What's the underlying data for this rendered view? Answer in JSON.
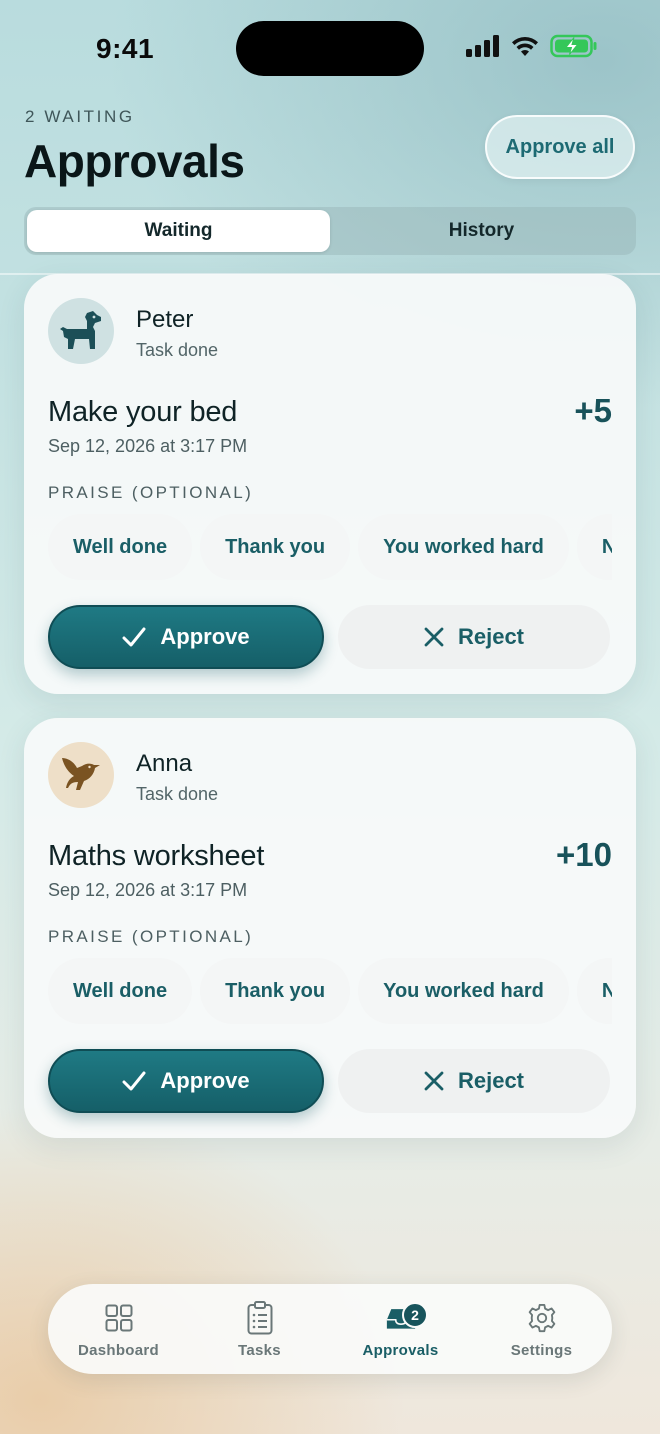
{
  "status_bar": {
    "time": "9:41"
  },
  "header": {
    "waiting_count": "2 WAITING",
    "title": "Approvals",
    "approve_all_label": "Approve all"
  },
  "segments": [
    {
      "label": "Waiting",
      "active": true
    },
    {
      "label": "History",
      "active": false
    }
  ],
  "approvals": [
    {
      "child_name": "Peter",
      "status": "Task done",
      "avatar_icon": "dog-icon",
      "avatar_bg": "#cfe1e2",
      "task_title": "Make your bed",
      "date": "Sep 12, 2026 at 3:17 PM",
      "points": "+5",
      "praise_label": "PRAISE (OPTIONAL)",
      "praise_chips": [
        "Well done",
        "Thank you",
        "You worked hard",
        "N"
      ],
      "approve_label": "Approve",
      "reject_label": "Reject"
    },
    {
      "child_name": "Anna",
      "status": "Task done",
      "avatar_icon": "bird-icon",
      "avatar_bg": "#eedfc8",
      "task_title": "Maths worksheet",
      "date": "Sep 12, 2026 at 3:17 PM",
      "points": "+10",
      "praise_label": "PRAISE (OPTIONAL)",
      "praise_chips": [
        "Well done",
        "Thank you",
        "You worked hard",
        "N"
      ],
      "approve_label": "Approve",
      "reject_label": "Reject"
    }
  ],
  "tabbar": {
    "items": [
      {
        "label": "Dashboard",
        "icon": "grid-icon",
        "active": false
      },
      {
        "label": "Tasks",
        "icon": "clipboard-icon",
        "active": false
      },
      {
        "label": "Approvals",
        "icon": "tray-icon",
        "active": true,
        "badge": "2"
      },
      {
        "label": "Settings",
        "icon": "gear-icon",
        "active": false
      }
    ]
  },
  "colors": {
    "accent": "#1a5e66",
    "approve_button": "#1b6d76",
    "battery": "#34c759"
  }
}
